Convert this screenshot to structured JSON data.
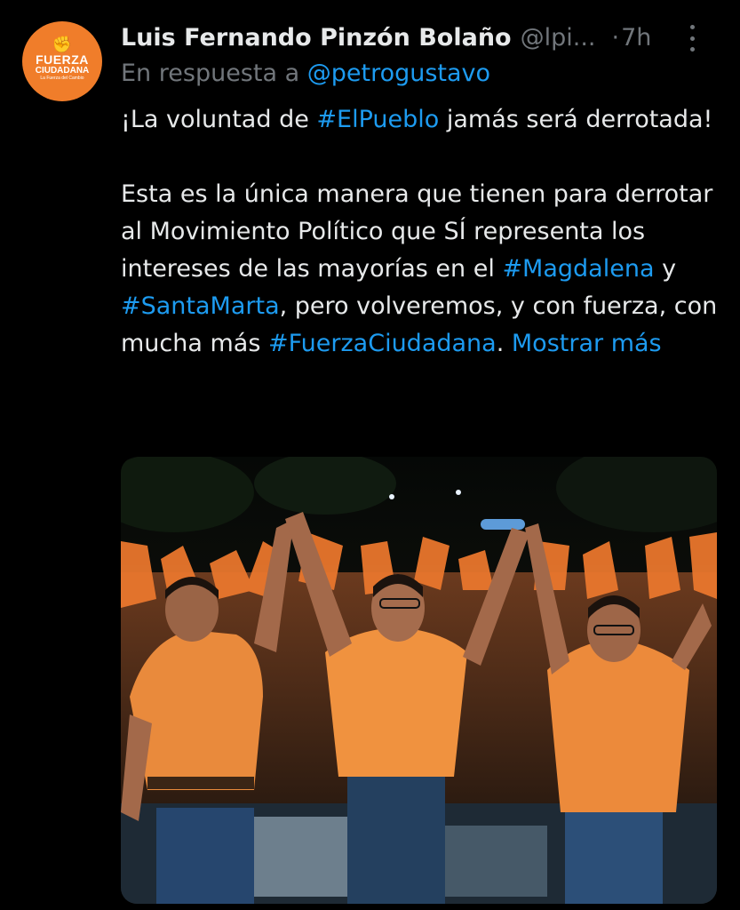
{
  "tweet": {
    "avatar": {
      "line1": "FUERZA",
      "line2": "CIUDADANA",
      "line3": "La Fuerza del Cambio"
    },
    "author_name": "Luis Fernando Pinzón Bolaño",
    "handle": "@lpi...",
    "separator": "·",
    "time": "7h",
    "reply_prefix": "En respuesta a",
    "reply_mention": "@petrogustavo",
    "text": {
      "p1_a": "¡La voluntad de ",
      "p1_tag": "#ElPueblo",
      "p1_b": " jamás será derrotada!",
      "p2_a": "Esta es la única manera que tienen para derrotar al Movimiento Político que SÍ representa los intereses de las mayorías en el ",
      "p2_tag1": "#Magdalena",
      "p2_b": " y ",
      "p2_tag2": "#SantaMarta",
      "p2_c": ", pero volveremos, y con fuerza, con mucha más ",
      "p2_tag3": "#FuerzaCiudadana",
      "p2_d": ". ",
      "show_more": "Mostrar más"
    }
  },
  "colors": {
    "background": "#000000",
    "text": "#e7e9ea",
    "muted": "#71767b",
    "link": "#1d9bf0",
    "brand_orange": "#f07d2a"
  },
  "icons": [
    "fist-icon",
    "more-options-icon"
  ]
}
